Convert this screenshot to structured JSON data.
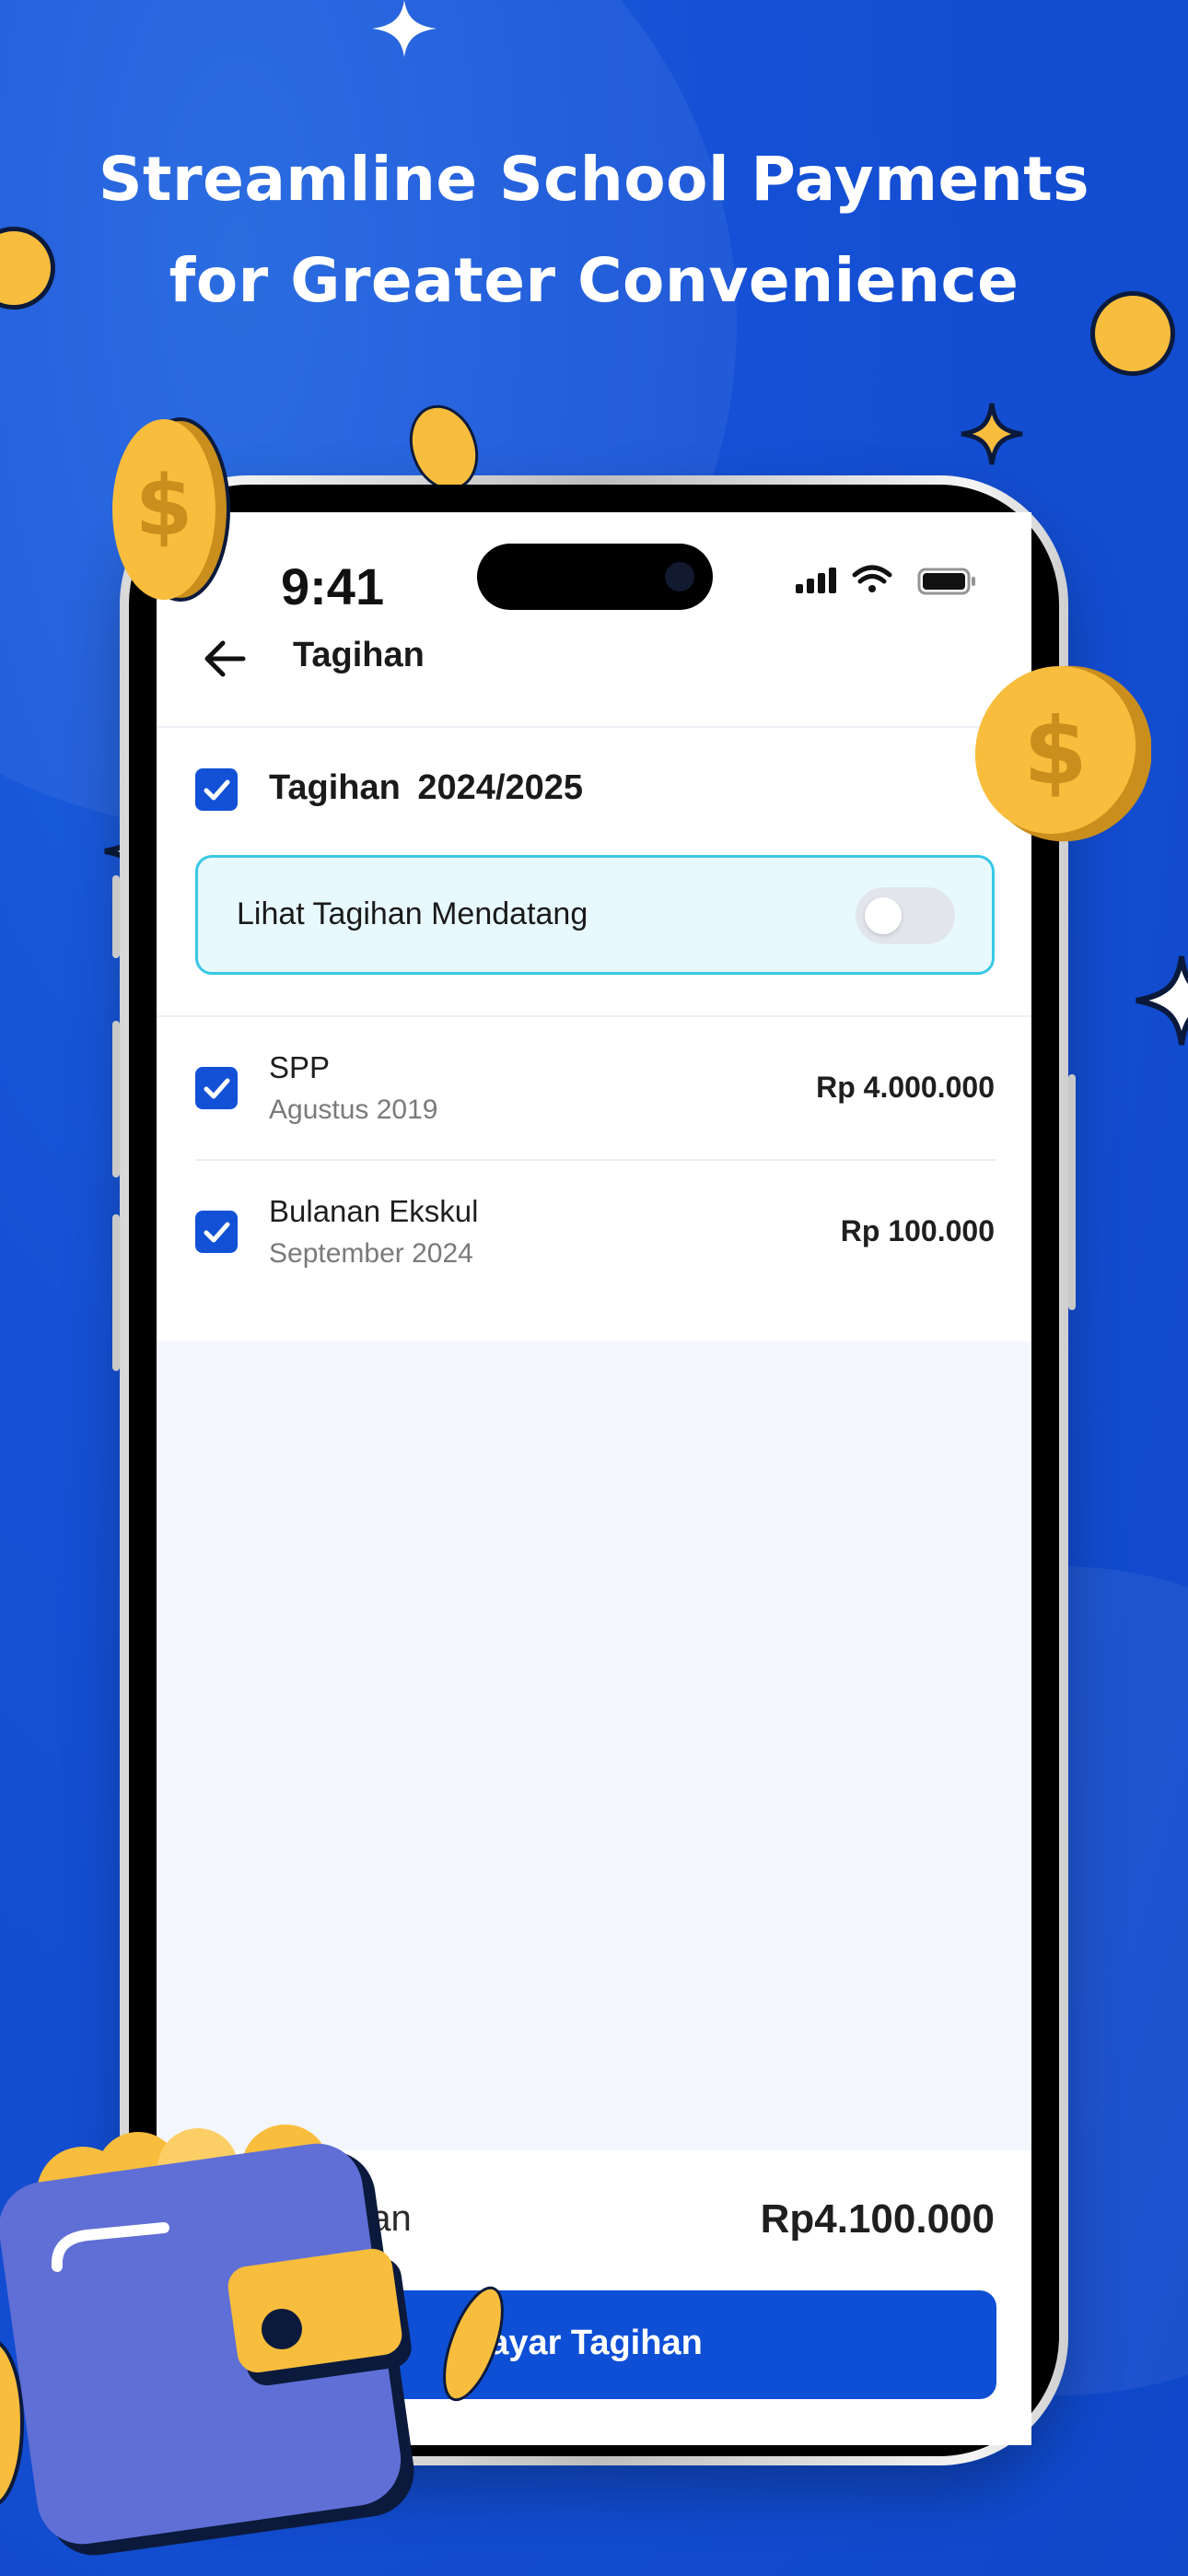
{
  "headline": {
    "line1": "Streamline School Payments",
    "line2": "for Greater Convenience"
  },
  "status_bar": {
    "time": "9:41"
  },
  "header": {
    "title": "Tagihan",
    "back_icon": "arrow-left-icon"
  },
  "bill_group": {
    "title": "Tagihan 2024/2025",
    "checked": true,
    "upcoming_toggle": {
      "label": "Lihat Tagihan Mendatang",
      "on": false
    }
  },
  "bills": [
    {
      "name": "SPP",
      "period": "Agustus 2019",
      "amount": "Rp 4.000.000",
      "checked": true
    },
    {
      "name": "Bulanan Ekskul",
      "period": "September 2024",
      "amount": "Rp 100.000",
      "checked": true
    }
  ],
  "footer": {
    "total_label": "nan",
    "total_value": "Rp4.100.000",
    "pay_button": "ayar Tagihan"
  },
  "colors": {
    "background": "#1551d6",
    "accent": "#0e4fd6",
    "coin": "#f8bd3c",
    "info_box_border": "#38c8e6"
  }
}
